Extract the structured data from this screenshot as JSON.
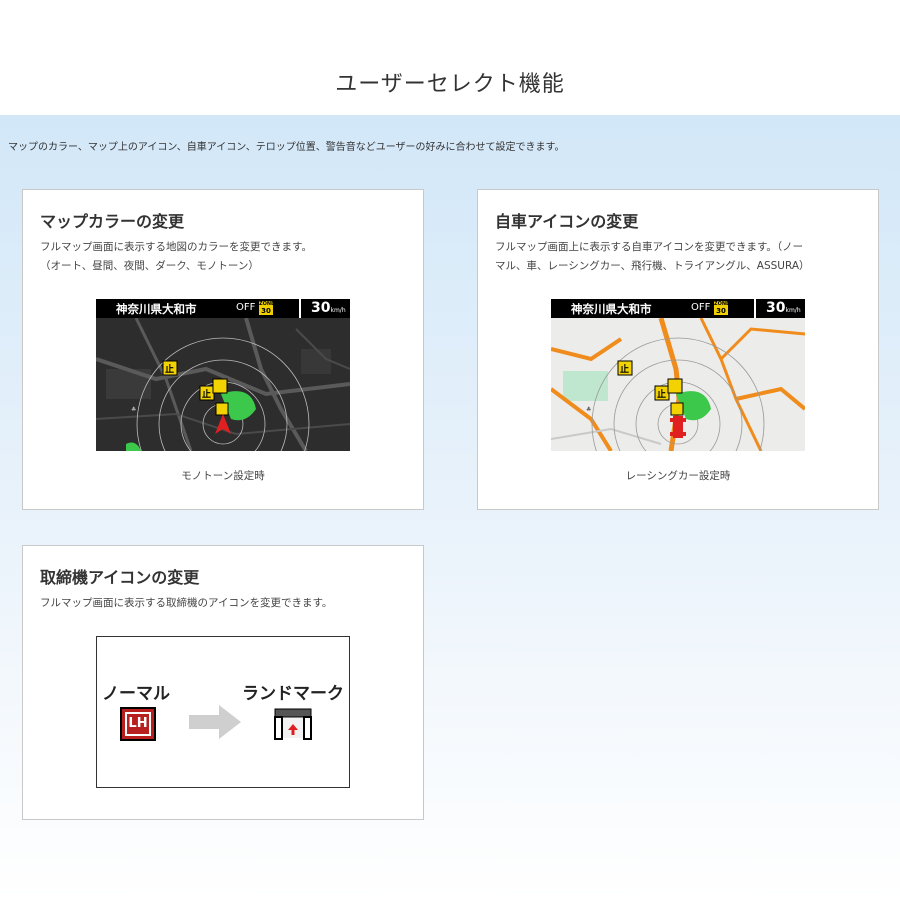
{
  "page": {
    "title": "ユーザーセレクト機能",
    "intro": "マップのカラー、マップ上のアイコン、自車アイコン、テロップ位置、警告音などユーザーの好みに合わせて設定できます。"
  },
  "cards": [
    {
      "title": "マップカラーの変更",
      "desc_line1": "フルマップ画面に表示する地図のカラーを変更できます。",
      "desc_line2": "（オート、昼間、夜間、ダーク、モノトーン）",
      "caption": "モノトーン設定時",
      "screen": {
        "location": "神奈川県大和市",
        "status": "OFF",
        "zone_label": "ZONE",
        "zone_speed": "30",
        "speed": "30",
        "speed_unit": "km/h",
        "stop_sign": "止"
      }
    },
    {
      "title": "自車アイコンの変更",
      "desc_line1": "フルマップ画面上に表示する自車アイコンを変更できます。（ノー",
      "desc_line2": "マル、車、レーシングカー、飛行機、トライアングル、ASSURA）",
      "caption": "レーシングカー設定時",
      "screen": {
        "location": "神奈川県大和市",
        "status": "OFF",
        "zone_label": "ZONE",
        "zone_speed": "30",
        "speed": "30",
        "speed_unit": "km/h",
        "stop_sign": "止"
      }
    },
    {
      "title": "取締機アイコンの変更",
      "desc_line1": "フルマップ画面に表示する取締機のアイコンを変更できます。",
      "normal_label": "ノーマル",
      "landmark_label": "ランドマーク",
      "lh_icon_text": "LH"
    }
  ],
  "colors": {
    "band_top": "#d2e7f8",
    "monotone_map_bg": "#2d2d2d",
    "day_map_bg": "#ececea",
    "road_orange": "#f08c1c",
    "zone_green": "#3cc84a",
    "sign_yellow": "#f2d200",
    "vehicle_red": "#e02020"
  }
}
